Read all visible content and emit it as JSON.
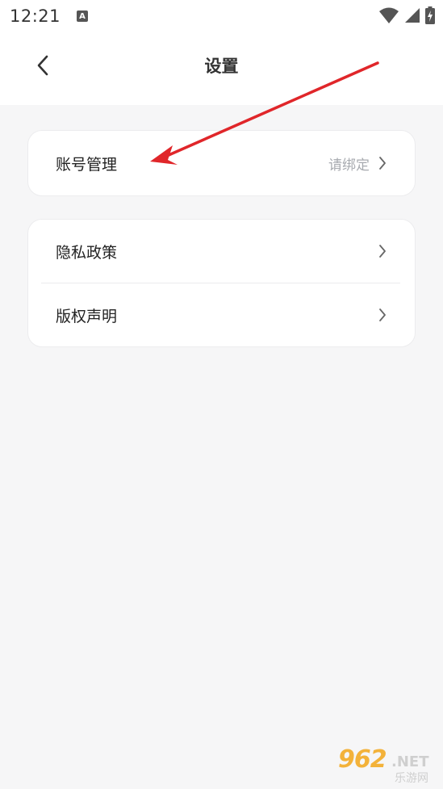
{
  "status_bar": {
    "time": "12:21",
    "notification_glyph": "A",
    "icons": [
      "wifi-icon",
      "signal-icon",
      "battery-charging-icon"
    ]
  },
  "header": {
    "title": "设置",
    "back_icon": "chevron-left-icon"
  },
  "account_card": {
    "items": [
      {
        "label": "账号管理",
        "value": "请绑定"
      }
    ]
  },
  "info_card": {
    "items": [
      {
        "label": "隐私政策"
      },
      {
        "label": "版权声明"
      }
    ]
  },
  "annotation": {
    "arrow_color": "#e0262a"
  },
  "watermark": {
    "number": "962",
    "suffix": ".NET",
    "text": "乐游网"
  },
  "colors": {
    "background": "#f6f6f7",
    "card": "#ffffff",
    "secondary_text": "#a8abb0"
  }
}
